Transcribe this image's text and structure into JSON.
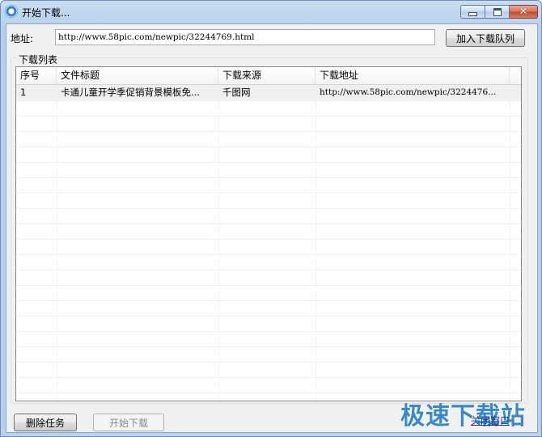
{
  "window": {
    "title": "开始下载...",
    "colors": {
      "frame": "#b9d1ec",
      "client": "#f0f0f0",
      "close": "#c2472e"
    }
  },
  "address": {
    "label": "地址:",
    "value": "http://www.58pic.com/newpic/32244769.html"
  },
  "toolbar": {
    "add_label": "加入下载队列"
  },
  "group": {
    "legend": "下载列表"
  },
  "table": {
    "columns": [
      "序号",
      "文件标题",
      "下载来源",
      "下载地址"
    ],
    "rows": [
      {
        "index": "1",
        "title": "卡通儿童开学季促销背景模板免...",
        "source": "千图网",
        "url": "http://www.58pic.com/newpic/3224476..."
      }
    ]
  },
  "footer": {
    "delete_label": "删除任务",
    "start_label": "开始下载",
    "close_link": "关闭窗口"
  },
  "watermark": {
    "text": "极速下载站"
  }
}
